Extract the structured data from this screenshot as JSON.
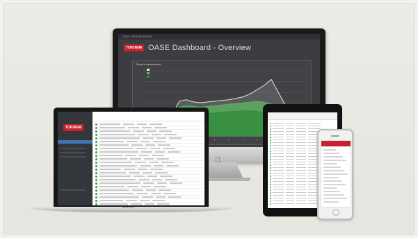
{
  "imac": {
    "topbar_text": "OASE WEB BROWSER",
    "brand_label": "TOKHEIM",
    "dashboard_title": "OASE Dashboard - Overview",
    "panel_title": "Today's transactions"
  },
  "chart_data": {
    "type": "area",
    "x": [
      0,
      1,
      2,
      3,
      4,
      5,
      6,
      7,
      8,
      9,
      10,
      11,
      12,
      13,
      14,
      15,
      16,
      17,
      18,
      19,
      20,
      21,
      22,
      23
    ],
    "series": [
      {
        "values": [
          10,
          12,
          14,
          16,
          30,
          48,
          50,
          47,
          46,
          47,
          48,
          49,
          50,
          52,
          54,
          58,
          64,
          70,
          78,
          60,
          42,
          30,
          22,
          16
        ]
      },
      {
        "values": [
          8,
          10,
          12,
          14,
          24,
          40,
          42,
          41,
          40,
          41,
          42,
          43,
          44,
          45,
          46,
          47,
          48,
          47,
          44,
          36,
          26,
          20,
          14,
          10
        ]
      },
      {
        "values": [
          6,
          8,
          9,
          10,
          16,
          28,
          30,
          30,
          30,
          31,
          32,
          33,
          34,
          34,
          35,
          35,
          34,
          33,
          30,
          24,
          18,
          14,
          10,
          8
        ]
      }
    ],
    "ylim": [
      0,
      90
    ],
    "grid": true,
    "colors": [
      "#e6e6e6",
      "#5cb85c",
      "#2e8b3b"
    ]
  },
  "laptop": {
    "brand_label": "TOKHEIM",
    "model_label": "MacBook Air"
  }
}
